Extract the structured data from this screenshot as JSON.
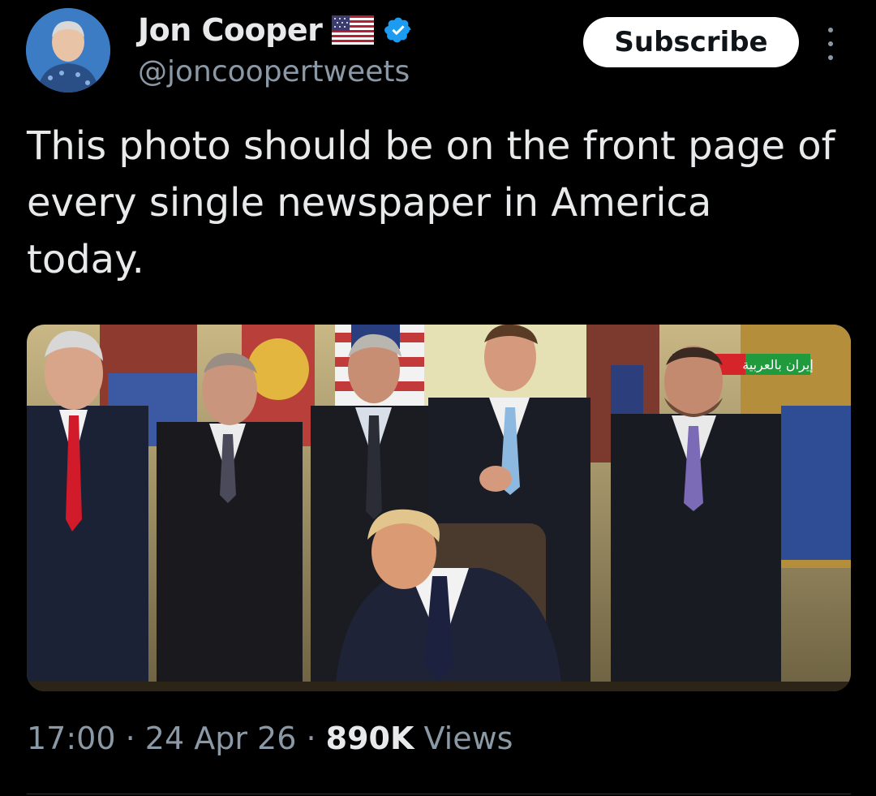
{
  "author": {
    "name": "Jon Cooper",
    "handle": "@joncoopertweets",
    "flag_icon": "us-flag-icon",
    "verified_icon": "verified-badge-icon",
    "verified_color": "#1d9bf0"
  },
  "actions": {
    "subscribe_label": "Subscribe",
    "more_icon": "more-vertical-icon"
  },
  "tweet": {
    "text": "This photo should be on the front page of every single newspaper in America today."
  },
  "media": {
    "watermark": "إيران بالعربية"
  },
  "meta": {
    "time": "17:00",
    "sep1": " · ",
    "date": "24 Apr 26",
    "sep2": " · ",
    "views_count": "890K",
    "views_label": " Views"
  },
  "colors": {
    "background": "#000000",
    "text_primary": "#e7e9ea",
    "text_secondary": "#8b98a5"
  }
}
